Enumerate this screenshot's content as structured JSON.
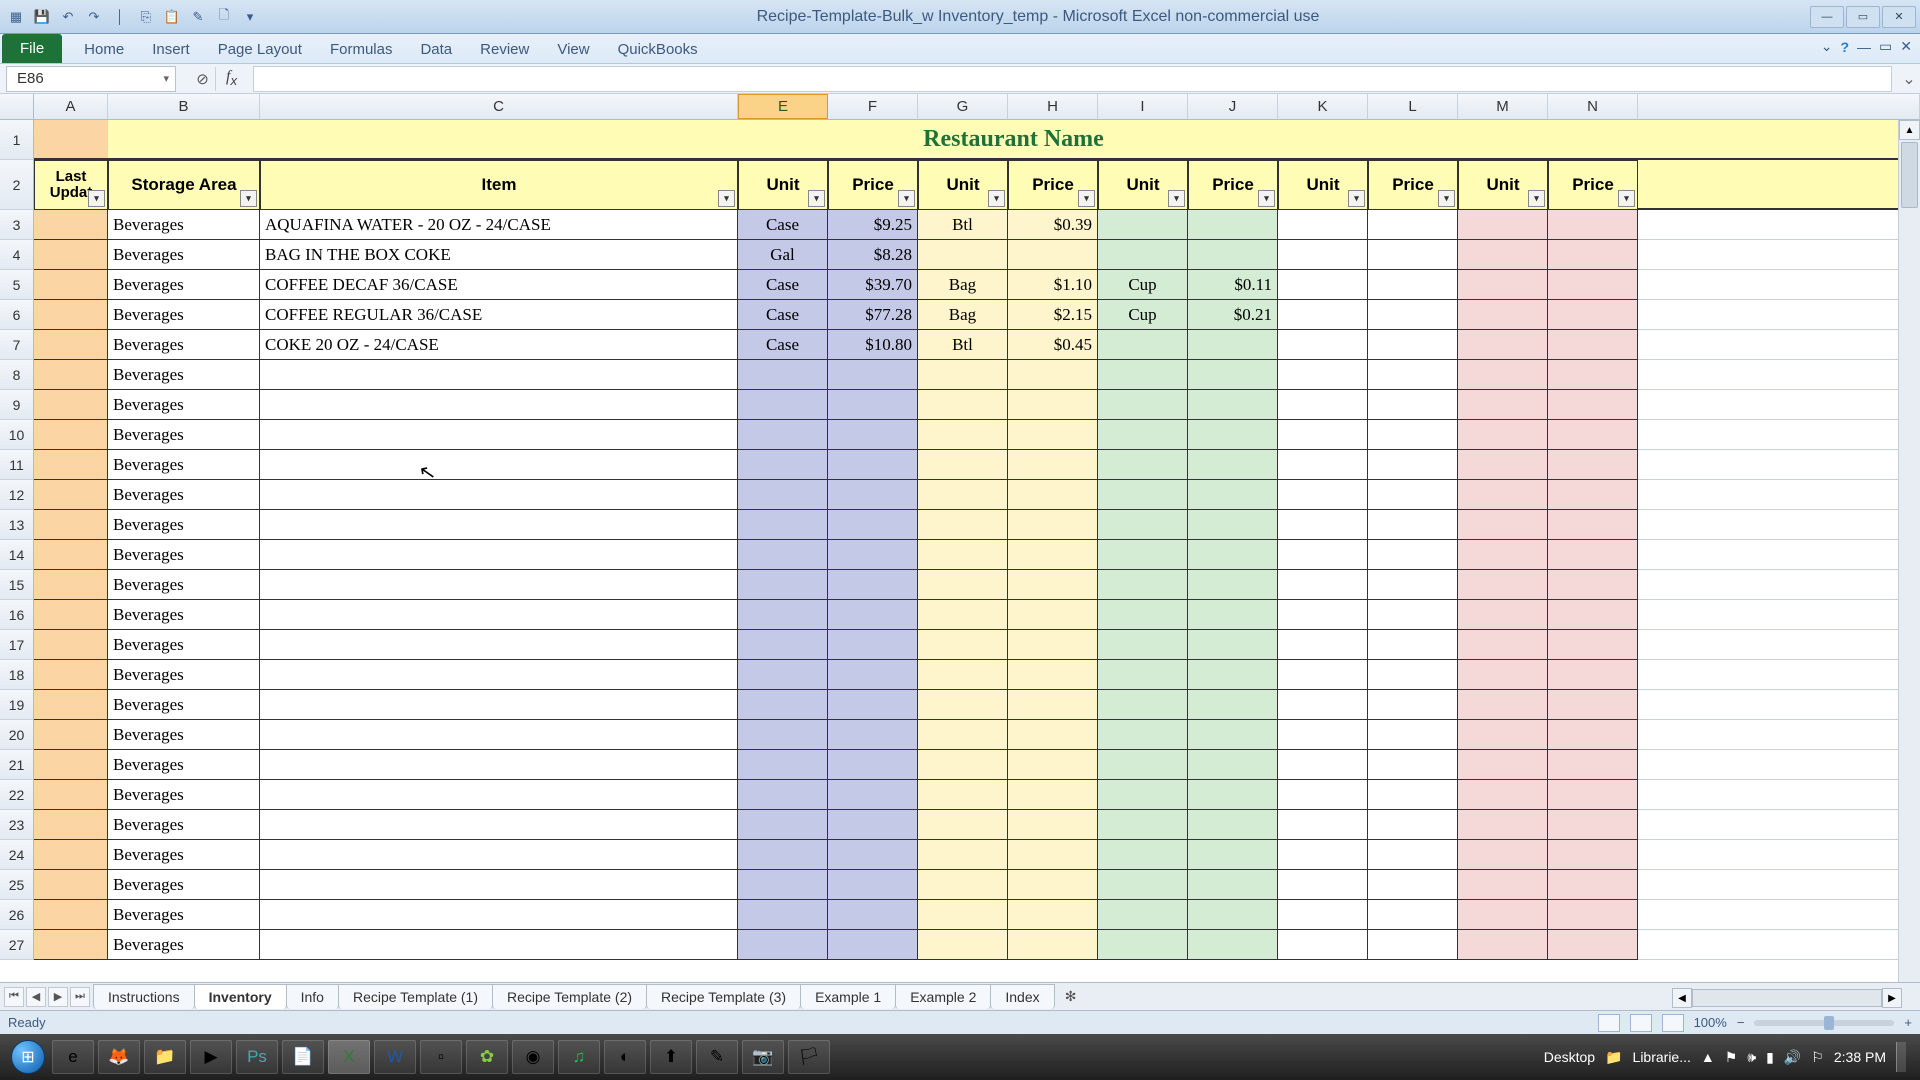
{
  "window": {
    "title": "Recipe-Template-Bulk_w Inventory_temp - Microsoft Excel non-commercial use"
  },
  "ribbon": {
    "file": "File",
    "tabs": [
      "Home",
      "Insert",
      "Page Layout",
      "Formulas",
      "Data",
      "Review",
      "View",
      "QuickBooks"
    ]
  },
  "namebox": "E86",
  "formula": "",
  "col_letters": [
    "A",
    "B",
    "C",
    "E",
    "F",
    "G",
    "H",
    "I",
    "J",
    "K",
    "L",
    "M",
    "N"
  ],
  "selected_col": "E",
  "banner": "Restaurant Name",
  "headers": {
    "A": "Last Updat",
    "B": "Storage Area",
    "C": "Item",
    "E": "Unit",
    "F": "Price",
    "G": "Unit",
    "H": "Price",
    "I": "Unit",
    "J": "Price",
    "K": "Unit",
    "L": "Price",
    "M": "Unit",
    "N": "Price"
  },
  "rows": [
    {
      "n": 3,
      "b": "Beverages",
      "c": "AQUAFINA WATER - 20 OZ - 24/CASE",
      "e": "Case",
      "f": "$9.25",
      "g": "Btl",
      "h": "$0.39",
      "i": "",
      "j": ""
    },
    {
      "n": 4,
      "b": "Beverages",
      "c": "BAG IN THE BOX COKE",
      "e": "Gal",
      "f": "$8.28",
      "g": "",
      "h": "",
      "i": "",
      "j": ""
    },
    {
      "n": 5,
      "b": "Beverages",
      "c": "COFFEE DECAF 36/CASE",
      "e": "Case",
      "f": "$39.70",
      "g": "Bag",
      "h": "$1.10",
      "i": "Cup",
      "j": "$0.11"
    },
    {
      "n": 6,
      "b": "Beverages",
      "c": "COFFEE REGULAR 36/CASE",
      "e": "Case",
      "f": "$77.28",
      "g": "Bag",
      "h": "$2.15",
      "i": "Cup",
      "j": "$0.21"
    },
    {
      "n": 7,
      "b": "Beverages",
      "c": "COKE 20 OZ - 24/CASE",
      "e": "Case",
      "f": "$10.80",
      "g": "Btl",
      "h": "$0.45",
      "i": "",
      "j": ""
    },
    {
      "n": 8,
      "b": "Beverages"
    },
    {
      "n": 9,
      "b": "Beverages"
    },
    {
      "n": 10,
      "b": "Beverages"
    },
    {
      "n": 11,
      "b": "Beverages"
    },
    {
      "n": 12,
      "b": "Beverages"
    },
    {
      "n": 13,
      "b": "Beverages"
    },
    {
      "n": 14,
      "b": "Beverages"
    },
    {
      "n": 15,
      "b": "Beverages"
    },
    {
      "n": 16,
      "b": "Beverages"
    },
    {
      "n": 17,
      "b": "Beverages"
    },
    {
      "n": 18,
      "b": "Beverages"
    },
    {
      "n": 19,
      "b": "Beverages"
    },
    {
      "n": 20,
      "b": "Beverages"
    },
    {
      "n": 21,
      "b": "Beverages"
    },
    {
      "n": 22,
      "b": "Beverages"
    },
    {
      "n": 23,
      "b": "Beverages"
    },
    {
      "n": 24,
      "b": "Beverages"
    },
    {
      "n": 25,
      "b": "Beverages"
    },
    {
      "n": 26,
      "b": "Beverages"
    },
    {
      "n": 27,
      "b": "Beverages"
    }
  ],
  "sheets": [
    "Instructions",
    "Inventory",
    "Info",
    "Recipe Template (1)",
    "Recipe Template (2)",
    "Recipe Template (3)",
    "Example 1",
    "Example 2",
    "Index"
  ],
  "active_sheet": "Inventory",
  "status": "Ready",
  "zoom": "100%",
  "taskbar": {
    "desktop": "Desktop",
    "libraries": "Librarie...",
    "time": "2:38 PM"
  }
}
